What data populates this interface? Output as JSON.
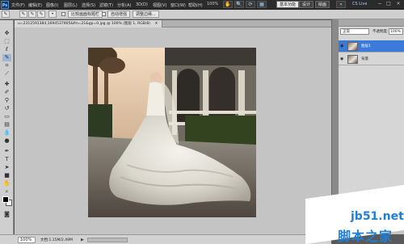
{
  "app": {
    "logo": "Ps"
  },
  "menu": {
    "items": [
      "文件(F)",
      "编辑(E)",
      "图像(I)",
      "图层(L)",
      "选择(S)",
      "滤镜(T)",
      "分析(A)",
      "3D(D)",
      "视图(V)",
      "窗口(W)",
      "帮助(H)"
    ],
    "zoom": "100%"
  },
  "workspace_buttons": [
    "基本功能",
    "设计",
    "绘画"
  ],
  "cslive": "CS Live",
  "window_controls": [
    "−",
    "□",
    "×"
  ],
  "options": {
    "buttons": [
      "比较画面标题栏",
      "自动增强",
      "调整边缘..."
    ]
  },
  "document": {
    "tab_title": "u=2312591384,1694537905&fm=21&gp=0.jpg @ 100% (图层 1, RGB/8)",
    "close": "×"
  },
  "status": {
    "zoom": "100%",
    "doc_size": "文档:1.15M/2.49M",
    "arrow": "▶"
  },
  "layers_panel": {
    "blend_mode": "正常",
    "opacity_label": "不透明度:",
    "opacity_value": "100%",
    "layers": [
      {
        "name": "图层1",
        "selected": true
      },
      {
        "name": "背景",
        "selected": false
      }
    ]
  },
  "watermark": {
    "top": "jb51.net",
    "bottom": "脚本之家"
  },
  "colors": {
    "accent": "#3b7ad8",
    "watermark": "#1f7fd6",
    "canvas_bg": "#c4c4c4"
  }
}
